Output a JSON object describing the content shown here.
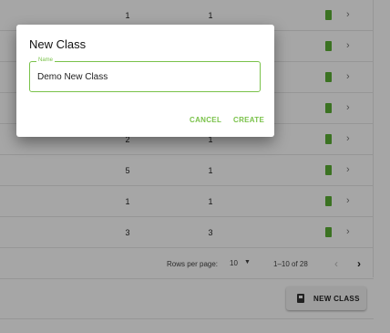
{
  "table": {
    "rows": [
      {
        "col1": "1",
        "col2": "1"
      },
      {
        "col1": "",
        "col2": ""
      },
      {
        "col1": "",
        "col2": ""
      },
      {
        "col1": "",
        "col2": ""
      },
      {
        "col1": "2",
        "col2": "1"
      },
      {
        "col1": "5",
        "col2": "1"
      },
      {
        "col1": "1",
        "col2": "1"
      },
      {
        "col1": "3",
        "col2": "3"
      }
    ],
    "chevron": "›",
    "tag_color": "#5bb035"
  },
  "pagination": {
    "rows_per_page_label": "Rows per page:",
    "rows_per_page_value": "10",
    "caret": "▼",
    "range_text": "1–10 of 28",
    "prev_icon": "‹",
    "next_icon": "›"
  },
  "footer": {
    "new_class_label": "NEW CLASS",
    "icon": "book-icon"
  },
  "dialog": {
    "title": "New Class",
    "field_label": "Name",
    "field_value": "Demo New Class",
    "cancel_label": "CANCEL",
    "create_label": "CREATE",
    "accent_color": "#7ac24a"
  }
}
